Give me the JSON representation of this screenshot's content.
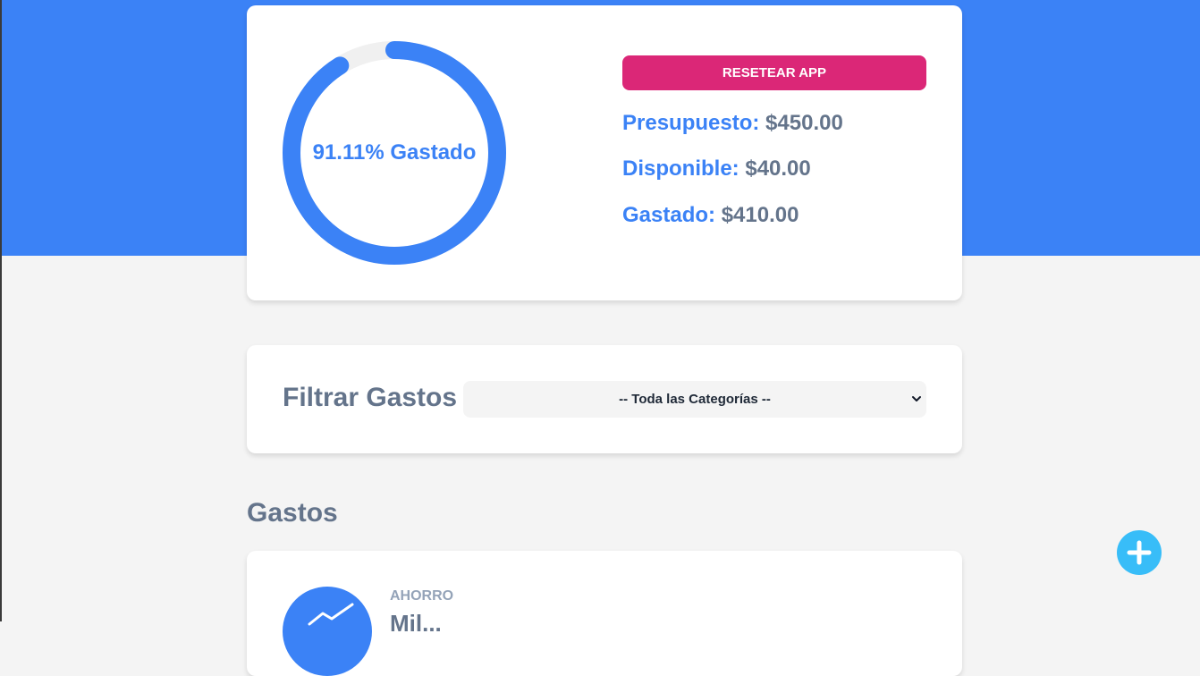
{
  "budget": {
    "progress_percent": 91.11,
    "progress_label": "91.11% Gastado",
    "reset_label": "Resetear App",
    "presupuesto_label": "Presupuesto:",
    "presupuesto_value": "$450.00",
    "disponible_label": "Disponible:",
    "disponible_value": "$40.00",
    "gastado_label": "Gastado:",
    "gastado_value": "$410.00"
  },
  "filter": {
    "title": "Filtrar Gastos",
    "selected_option": "-- Toda las Categorías --"
  },
  "expenses": {
    "section_title": "Gastos",
    "items": [
      {
        "category": "Ahorro",
        "name": "Mil...",
        "icon": "savings-chart-icon"
      }
    ]
  },
  "fab": {
    "icon": "plus-icon"
  },
  "colors": {
    "accent": "#3b82f6",
    "reset": "#db2777",
    "fab": "#38bdf8",
    "muted_text": "#64748b",
    "background": "#f4f4f4"
  }
}
